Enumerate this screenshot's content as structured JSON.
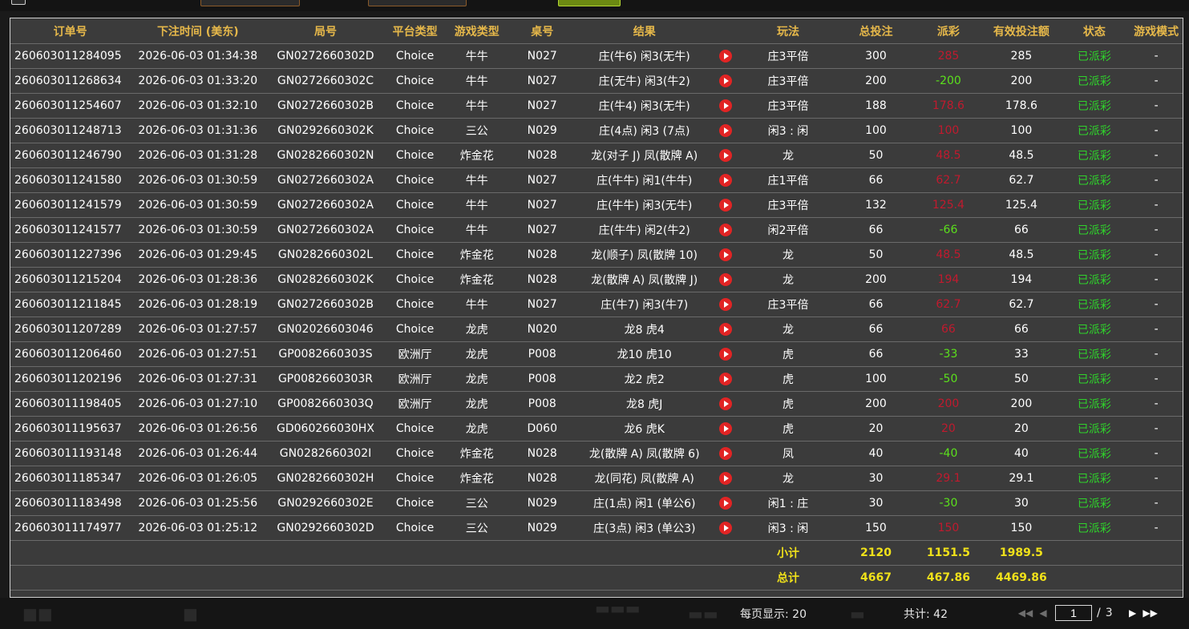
{
  "columns": [
    "订单号",
    "下注时间 (美东)",
    "局号",
    "平台类型",
    "游戏类型",
    "桌号",
    "结果",
    "",
    "玩法",
    "总投注",
    "派彩",
    "有效投注额",
    "状态",
    "游戏模式"
  ],
  "rows": [
    {
      "order": "260603011284095",
      "time": "2026-06-03 01:34:38",
      "round": "GN0272660302D",
      "platform": "Choice",
      "game": "牛牛",
      "table": "N027",
      "result": "庄(牛6) 闲3(无牛)",
      "play": "庄3平倍",
      "bet": "300",
      "payout": "285",
      "payout_sign": "pos",
      "valid": "285",
      "status": "已派彩",
      "mode": "-"
    },
    {
      "order": "260603011268634",
      "time": "2026-06-03 01:33:20",
      "round": "GN0272660302C",
      "platform": "Choice",
      "game": "牛牛",
      "table": "N027",
      "result": "庄(无牛) 闲3(牛2)",
      "play": "庄3平倍",
      "bet": "200",
      "payout": "-200",
      "payout_sign": "neg",
      "valid": "200",
      "status": "已派彩",
      "mode": "-"
    },
    {
      "order": "260603011254607",
      "time": "2026-06-03 01:32:10",
      "round": "GN0272660302B",
      "platform": "Choice",
      "game": "牛牛",
      "table": "N027",
      "result": "庄(牛4) 闲3(无牛)",
      "play": "庄3平倍",
      "bet": "188",
      "payout": "178.6",
      "payout_sign": "pos",
      "valid": "178.6",
      "status": "已派彩",
      "mode": "-"
    },
    {
      "order": "260603011248713",
      "time": "2026-06-03 01:31:36",
      "round": "GN0292660302K",
      "platform": "Choice",
      "game": "三公",
      "table": "N029",
      "result": "庄(4点) 闲3 (7点)",
      "play": "闲3 : 闲",
      "bet": "100",
      "payout": "100",
      "payout_sign": "pos",
      "valid": "100",
      "status": "已派彩",
      "mode": "-"
    },
    {
      "order": "260603011246790",
      "time": "2026-06-03 01:31:28",
      "round": "GN0282660302N",
      "platform": "Choice",
      "game": "炸金花",
      "table": "N028",
      "result": "龙(对子 J) 凤(散牌 A)",
      "play": "龙",
      "bet": "50",
      "payout": "48.5",
      "payout_sign": "pos",
      "valid": "48.5",
      "status": "已派彩",
      "mode": "-"
    },
    {
      "order": "260603011241580",
      "time": "2026-06-03 01:30:59",
      "round": "GN0272660302A",
      "platform": "Choice",
      "game": "牛牛",
      "table": "N027",
      "result": "庄(牛牛) 闲1(牛牛)",
      "play": "庄1平倍",
      "bet": "66",
      "payout": "62.7",
      "payout_sign": "pos",
      "valid": "62.7",
      "status": "已派彩",
      "mode": "-"
    },
    {
      "order": "260603011241579",
      "time": "2026-06-03 01:30:59",
      "round": "GN0272660302A",
      "platform": "Choice",
      "game": "牛牛",
      "table": "N027",
      "result": "庄(牛牛) 闲3(无牛)",
      "play": "庄3平倍",
      "bet": "132",
      "payout": "125.4",
      "payout_sign": "pos",
      "valid": "125.4",
      "status": "已派彩",
      "mode": "-"
    },
    {
      "order": "260603011241577",
      "time": "2026-06-03 01:30:59",
      "round": "GN0272660302A",
      "platform": "Choice",
      "game": "牛牛",
      "table": "N027",
      "result": "庄(牛牛) 闲2(牛2)",
      "play": "闲2平倍",
      "bet": "66",
      "payout": "-66",
      "payout_sign": "neg",
      "valid": "66",
      "status": "已派彩",
      "mode": "-"
    },
    {
      "order": "260603011227396",
      "time": "2026-06-03 01:29:45",
      "round": "GN0282660302L",
      "platform": "Choice",
      "game": "炸金花",
      "table": "N028",
      "result": "龙(顺子) 凤(散牌 10)",
      "play": "龙",
      "bet": "50",
      "payout": "48.5",
      "payout_sign": "pos",
      "valid": "48.5",
      "status": "已派彩",
      "mode": "-"
    },
    {
      "order": "260603011215204",
      "time": "2026-06-03 01:28:36",
      "round": "GN0282660302K",
      "platform": "Choice",
      "game": "炸金花",
      "table": "N028",
      "result": "龙(散牌 A) 凤(散牌 J)",
      "play": "龙",
      "bet": "200",
      "payout": "194",
      "payout_sign": "pos",
      "valid": "194",
      "status": "已派彩",
      "mode": "-"
    },
    {
      "order": "260603011211845",
      "time": "2026-06-03 01:28:19",
      "round": "GN0272660302B",
      "platform": "Choice",
      "game": "牛牛",
      "table": "N027",
      "result": "庄(牛7) 闲3(牛7)",
      "play": "庄3平倍",
      "bet": "66",
      "payout": "62.7",
      "payout_sign": "pos",
      "valid": "62.7",
      "status": "已派彩",
      "mode": "-"
    },
    {
      "order": "260603011207289",
      "time": "2026-06-03 01:27:57",
      "round": "GN02026603046",
      "platform": "Choice",
      "game": "龙虎",
      "table": "N020",
      "result": "龙8 虎4",
      "play": "龙",
      "bet": "66",
      "payout": "66",
      "payout_sign": "pos",
      "valid": "66",
      "status": "已派彩",
      "mode": "-"
    },
    {
      "order": "260603011206460",
      "time": "2026-06-03 01:27:51",
      "round": "GP0082660303S",
      "platform": "欧洲厅",
      "game": "龙虎",
      "table": "P008",
      "result": "龙10 虎10",
      "play": "虎",
      "bet": "66",
      "payout": "-33",
      "payout_sign": "neg",
      "valid": "33",
      "status": "已派彩",
      "mode": "-"
    },
    {
      "order": "260603011202196",
      "time": "2026-06-03 01:27:31",
      "round": "GP0082660303R",
      "platform": "欧洲厅",
      "game": "龙虎",
      "table": "P008",
      "result": "龙2 虎2",
      "play": "虎",
      "bet": "100",
      "payout": "-50",
      "payout_sign": "neg",
      "valid": "50",
      "status": "已派彩",
      "mode": "-"
    },
    {
      "order": "260603011198405",
      "time": "2026-06-03 01:27:10",
      "round": "GP0082660303Q",
      "platform": "欧洲厅",
      "game": "龙虎",
      "table": "P008",
      "result": "龙8 虎J",
      "play": "虎",
      "bet": "200",
      "payout": "200",
      "payout_sign": "pos",
      "valid": "200",
      "status": "已派彩",
      "mode": "-"
    },
    {
      "order": "260603011195637",
      "time": "2026-06-03 01:26:56",
      "round": "GD060266030HX",
      "platform": "Choice",
      "game": "龙虎",
      "table": "D060",
      "result": "龙6 虎K",
      "play": "虎",
      "bet": "20",
      "payout": "20",
      "payout_sign": "pos",
      "valid": "20",
      "status": "已派彩",
      "mode": "-"
    },
    {
      "order": "260603011193148",
      "time": "2026-06-03 01:26:44",
      "round": "GN0282660302I",
      "platform": "Choice",
      "game": "炸金花",
      "table": "N028",
      "result": "龙(散牌 A) 凤(散牌 6)",
      "play": "凤",
      "bet": "40",
      "payout": "-40",
      "payout_sign": "neg",
      "valid": "40",
      "status": "已派彩",
      "mode": "-"
    },
    {
      "order": "260603011185347",
      "time": "2026-06-03 01:26:05",
      "round": "GN0282660302H",
      "platform": "Choice",
      "game": "炸金花",
      "table": "N028",
      "result": "龙(同花) 凤(散牌 A)",
      "play": "龙",
      "bet": "30",
      "payout": "29.1",
      "payout_sign": "pos",
      "valid": "29.1",
      "status": "已派彩",
      "mode": "-"
    },
    {
      "order": "260603011183498",
      "time": "2026-06-03 01:25:56",
      "round": "GN0292660302E",
      "platform": "Choice",
      "game": "三公",
      "table": "N029",
      "result": "庄(1点) 闲1 (单公6)",
      "play": "闲1 : 庄",
      "bet": "30",
      "payout": "-30",
      "payout_sign": "neg",
      "valid": "30",
      "status": "已派彩",
      "mode": "-"
    },
    {
      "order": "260603011174977",
      "time": "2026-06-03 01:25:12",
      "round": "GN0292660302D",
      "platform": "Choice",
      "game": "三公",
      "table": "N029",
      "result": "庄(3点) 闲3 (单公3)",
      "play": "闲3 : 闲",
      "bet": "150",
      "payout": "150",
      "payout_sign": "pos",
      "valid": "150",
      "status": "已派彩",
      "mode": "-"
    }
  ],
  "subtotal": {
    "label": "小计",
    "bet": "2120",
    "payout": "1151.5",
    "valid": "1989.5"
  },
  "total": {
    "label": "总计",
    "bet": "4667",
    "payout": "467.86",
    "valid": "4469.86"
  },
  "footer": {
    "page_size_label": "每页显示: 20",
    "total_label": "共计: 42",
    "current_page": "1",
    "separator": "/",
    "total_pages": "3"
  },
  "colors": {
    "header_text": "#e6b84a",
    "negative": "#5be01c",
    "positive": "#c11a2e",
    "status": "#2fd32b",
    "summary": "#f0e11a"
  },
  "icons": {
    "result_video": "play-circle-icon",
    "pager_first": "first-page-icon",
    "pager_prev": "prev-page-icon",
    "pager_next": "next-page-icon",
    "pager_last": "last-page-icon"
  }
}
